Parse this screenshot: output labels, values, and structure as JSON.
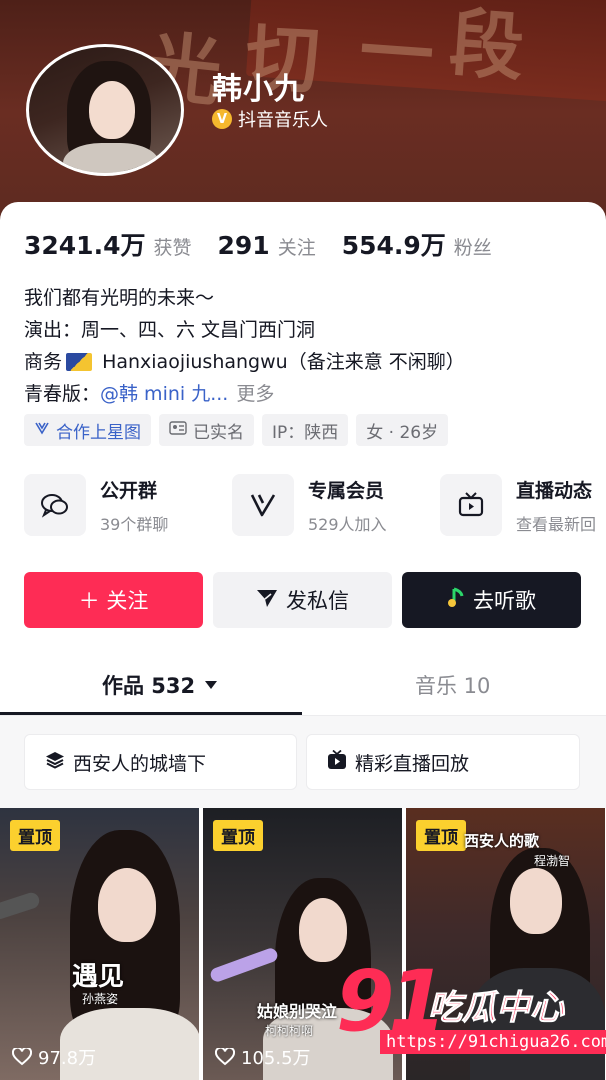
{
  "profile": {
    "name": "韩小九",
    "verify_label": "抖音音乐人",
    "banner_chars": [
      "光",
      "切",
      "一",
      "段"
    ]
  },
  "stats": [
    {
      "num": "3241.4万",
      "label": "获赞"
    },
    {
      "num": "291",
      "label": "关注"
    },
    {
      "num": "554.9万",
      "label": "粉丝"
    }
  ],
  "bio": {
    "line1": "我们都有光明的未来～",
    "line2": "演出：周一、四、六 文昌门西门洞",
    "line3_prefix": "商务",
    "line3_text": "Hanxiaojiushangwu（备注来意 不闲聊）",
    "line4_prefix": "青春版：",
    "line4_link": "@韩 mini 九...",
    "line4_more": "更多"
  },
  "tags": [
    {
      "icon": "star-map-icon",
      "label": "合作上星图"
    },
    {
      "icon": "id-card-icon",
      "label": "已实名"
    },
    {
      "label": "IP：陕西"
    },
    {
      "label": "女 · 26岁"
    }
  ],
  "features": [
    {
      "icon": "group-chat-icon",
      "title": "公开群",
      "sub": "39个群聊"
    },
    {
      "icon": "vip-v-icon",
      "title": "专属会员",
      "sub": "529人加入"
    },
    {
      "icon": "tv-icon",
      "title": "直播动态",
      "sub": "查看最新回"
    }
  ],
  "buttons": {
    "follow": "＋ 关注",
    "message": "发私信",
    "music": "去听歌"
  },
  "tabs": {
    "works": "作品 532",
    "music": "音乐 10"
  },
  "sections": {
    "s1": "西安人的城墙下",
    "s2": "精彩直播回放"
  },
  "videos": [
    {
      "pin": "置顶",
      "likes": "97.8万",
      "caption": "遇见",
      "caption_sub": "孙燕姿"
    },
    {
      "pin": "置顶",
      "likes": "105.5万",
      "caption": "姑娘别哭泣",
      "caption_sub": "柯柯柯啊"
    },
    {
      "pin": "置顶",
      "likes": "",
      "caption": "西安人的歌",
      "caption_sub": "程渤智"
    }
  ],
  "watermark": {
    "num": "91",
    "text": "吃瓜中心",
    "url": "https://91chigua26.com"
  },
  "colors": {
    "accent": "#fe2c55",
    "link": "#3a62c8",
    "pin": "#fbd02e",
    "dark": "#161823"
  }
}
